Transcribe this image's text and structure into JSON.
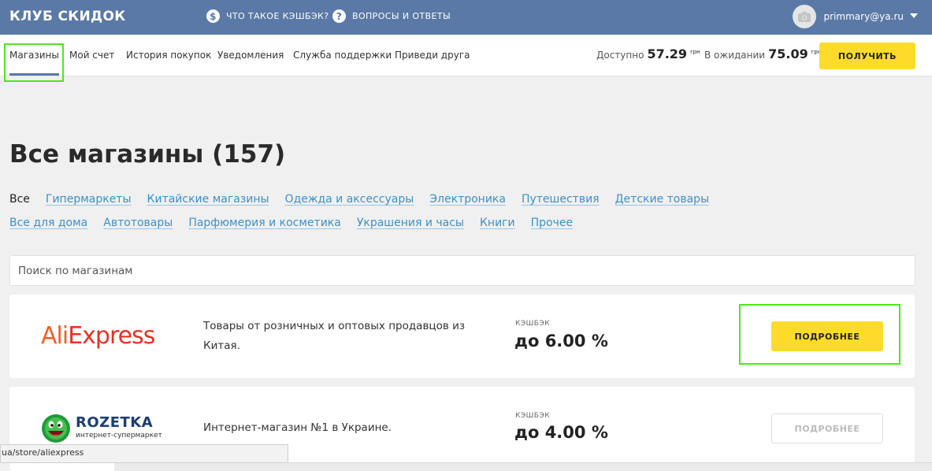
{
  "header": {
    "brand": "КЛУБ СКИДОК",
    "links": [
      {
        "icon": "dollar-icon",
        "glyph": "$",
        "label": "ЧТО ТАКОЕ КЭШБЭК?"
      },
      {
        "icon": "question-icon",
        "glyph": "?",
        "label": "ВОПРОСЫ И ОТВЕТЫ"
      }
    ],
    "user_email": "primmary@ya.ru"
  },
  "nav": {
    "items": [
      "Магазины",
      "Мой счет",
      "История покупок",
      "Уведомления",
      "Служба поддержки",
      "Приведи друга"
    ],
    "available_label": "Доступно",
    "available_value": "57.29",
    "pending_label": "В ожидании",
    "pending_value": "75.09",
    "currency": "грн",
    "get_button": "ПОЛУЧИТЬ"
  },
  "main": {
    "title": "Все магазины (157)",
    "categories_row1": [
      "Все",
      "Гипермаркеты",
      "Китайские магазины",
      "Одежда и аксессуары",
      "Электроника",
      "Путешествия",
      "Детские товары"
    ],
    "categories_row2": [
      "Все для дома",
      "Автотовары",
      "Парфюмерия и косметика",
      "Украшения и часы",
      "Книги",
      "Прочее"
    ],
    "search_placeholder": "Поиск по магазинам"
  },
  "stores": [
    {
      "logo_text_a": "Ali",
      "logo_text_b": "Express",
      "description": "Товары от розничных и оптовых продавцов из Китая.",
      "cashback_label": "КЭШБЭК",
      "cashback_value": "до 6.00 %",
      "button": "ПОДРОБНЕЕ"
    },
    {
      "logo_text_a": "ROZETKA",
      "logo_text_b": "интернет-супермаркет",
      "description": "Интернет-магазин №1 в Украине.",
      "cashback_label": "КЭШБЭК",
      "cashback_value": "до 4.00 %",
      "button": "ПОДРОБНЕЕ"
    }
  ],
  "status_url": "ua/store/aliexpress",
  "colors": {
    "header_bg": "#5a79a6",
    "accent_yellow": "#fddb2a",
    "link_blue": "#3a91cc",
    "highlight_green": "#4ce81b"
  }
}
